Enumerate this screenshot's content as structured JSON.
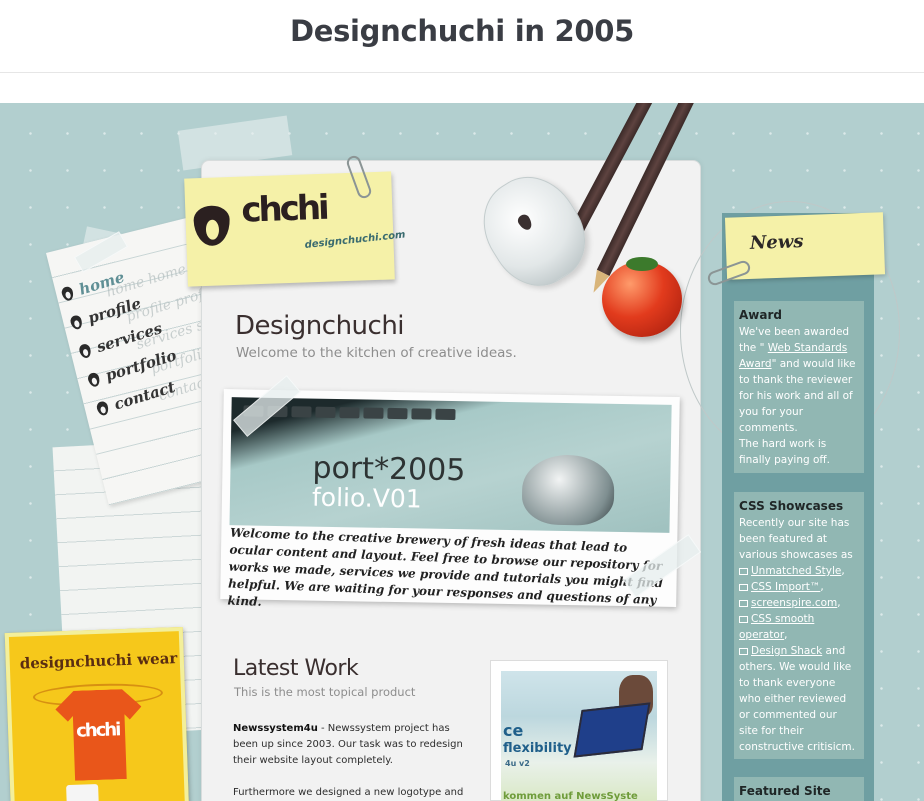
{
  "page": {
    "title": "Designchuchi in 2005"
  },
  "logo": {
    "mark": "chchi",
    "url": "designchuchi.com"
  },
  "nav": {
    "items": [
      {
        "label": "home"
      },
      {
        "label": "profile"
      },
      {
        "label": "services"
      },
      {
        "label": "portfolio"
      },
      {
        "label": "contact"
      }
    ]
  },
  "hero": {
    "title": "Designchuchi",
    "subtitle": "Welcome to the kitchen of creative ideas.",
    "photo_text_1": "port*2005",
    "photo_text_2": "folio.V01",
    "caption": "Welcome to the creative brewery of fresh ideas that lead to ocular content and layout. Feel free to browse our repository for works we made, services we provide and tutorials you might find helpful. We are waiting for your responses and questions of any kind."
  },
  "latest_work": {
    "title": "Latest Work",
    "subtitle": "This is the most topical product",
    "p1_strong": "Newssystem4u",
    "p1_rest": " - Newssystem project has been up since 2003. Our task was to redesign their website layout completely.",
    "p2": "Furthermore we designed a new logotype and",
    "thumb_ce": "ce",
    "thumb_flex": "flexibility",
    "thumb_v2": "4u v2",
    "thumb_bottom": "kommen auf NewsSyste"
  },
  "wear": {
    "title": "designchuchi wear",
    "shirt_logo": "chchi"
  },
  "news": {
    "heading": "News",
    "award": {
      "title": "Award",
      "before": "We've been awarded the \" ",
      "link": "Web Standards Award",
      "after": "\" and would like to thank the reviewer for his work and all of you for your comments.",
      "extra": "The hard work is finally paying off."
    },
    "css": {
      "title": "CSS Showcases",
      "intro": "Recently our site has been featured at various showcases as",
      "links": [
        "Unmatched Style",
        "CSS Import™",
        "screenspire.com",
        "CSS smooth operator",
        "Design Shack"
      ],
      "outro": " and others. We would like to thank everyone who either reviewed or commented our site for their constructive critisicm."
    },
    "featured": {
      "title": "Featured Site"
    }
  },
  "colors": {
    "background": "#b2cfcf",
    "accent": "#5f8f95",
    "note": "#f5f1a8",
    "sidebar": "#6f9fa2"
  }
}
